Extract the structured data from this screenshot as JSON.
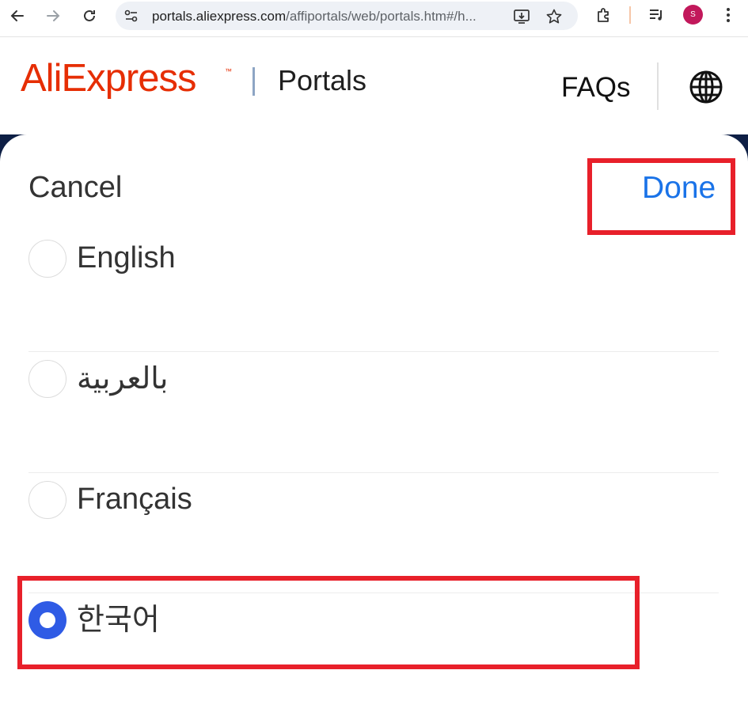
{
  "browser": {
    "url_host": "portals.aliexpress.com",
    "url_path": "/affiportals/web/portals.htm#/h...",
    "avatar_letter": "S",
    "icons": [
      "back-icon",
      "forward-icon",
      "reload-icon",
      "site-settings-icon",
      "install-app-icon",
      "bookmark-star-icon",
      "extensions-icon",
      "media-queue-icon",
      "more-menu-icon"
    ]
  },
  "header": {
    "logo_text": "AliExpress",
    "logo_tm": "™",
    "section": "Portals",
    "faqs": "FAQs",
    "globe_icon": "globe-icon"
  },
  "language_sheet": {
    "cancel_label": "Cancel",
    "done_label": "Done",
    "languages": [
      {
        "label": "English",
        "selected": false
      },
      {
        "label": "بالعربية",
        "selected": false
      },
      {
        "label": "Français",
        "selected": false
      },
      {
        "label": "한국어",
        "selected": true
      }
    ]
  },
  "colors": {
    "brand": "#e62e04",
    "done": "#1a73e8",
    "radio_selected": "#2f5be5",
    "highlight": "#e8202a"
  }
}
